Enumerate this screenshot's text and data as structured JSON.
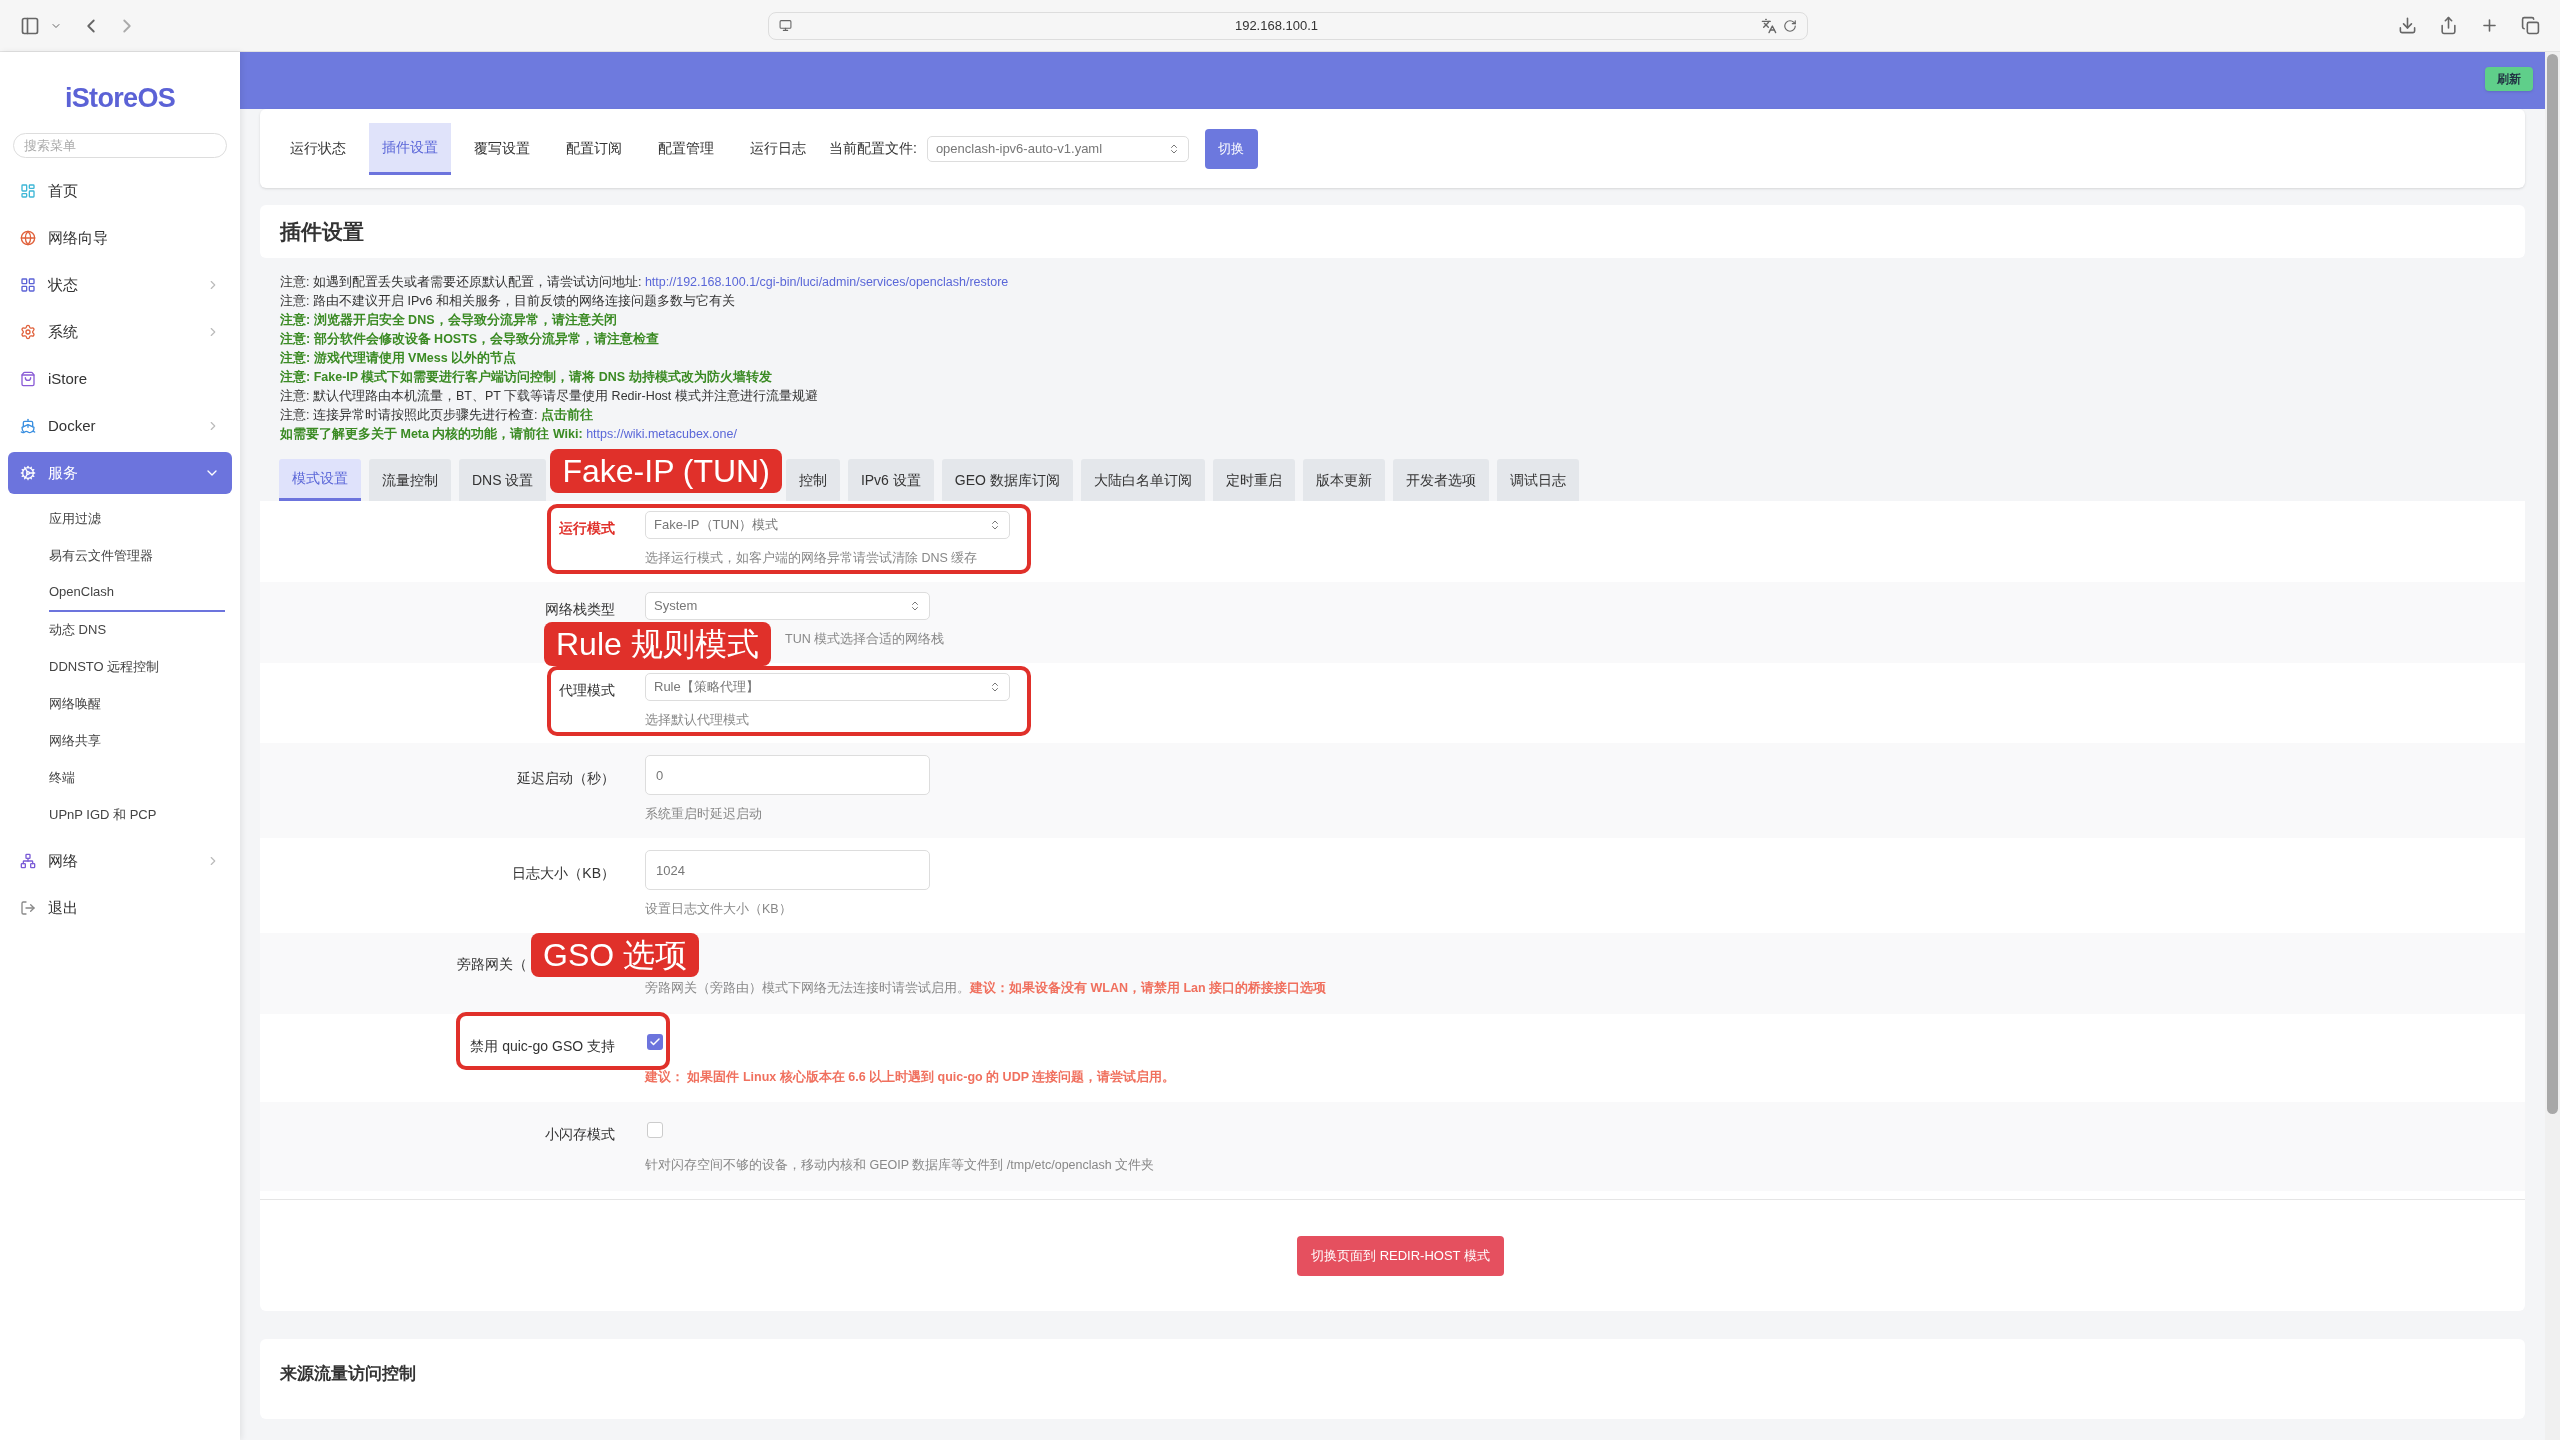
{
  "browser": {
    "url": "192.168.100.1"
  },
  "sidebar": {
    "logo": "iStoreOS",
    "search_placeholder": "搜索菜单",
    "items": [
      {
        "label": "首页",
        "selected": false
      },
      {
        "label": "网络向导",
        "selected": false
      },
      {
        "label": "状态",
        "selected": false,
        "expanded": false
      },
      {
        "label": "系统",
        "selected": false,
        "expanded": false
      },
      {
        "label": "iStore",
        "selected": false
      },
      {
        "label": "Docker",
        "selected": false,
        "expanded": false
      },
      {
        "label": "服务",
        "selected": true,
        "expanded": true,
        "children": [
          {
            "label": "应用过滤",
            "selected": false
          },
          {
            "label": "易有云文件管理器",
            "selected": false
          },
          {
            "label": "OpenClash",
            "selected": true
          },
          {
            "label": "动态 DNS",
            "selected": false
          },
          {
            "label": "DDNSTO 远程控制",
            "selected": false
          },
          {
            "label": "网络唤醒",
            "selected": false
          },
          {
            "label": "网络共享",
            "selected": false
          },
          {
            "label": "终端",
            "selected": false
          },
          {
            "label": "UPnP IGD 和 PCP",
            "selected": false
          }
        ]
      },
      {
        "label": "网络",
        "selected": false,
        "expanded": false
      },
      {
        "label": "退出",
        "selected": false
      }
    ]
  },
  "header": {
    "refresh_button": "刷新"
  },
  "top_tabs": [
    {
      "label": "运行状态",
      "selected": false
    },
    {
      "label": "插件设置",
      "selected": true
    },
    {
      "label": "覆写设置",
      "selected": false
    },
    {
      "label": "配置订阅",
      "selected": false
    },
    {
      "label": "配置管理",
      "selected": false
    },
    {
      "label": "运行日志",
      "selected": false
    }
  ],
  "config_file": {
    "label": "当前配置文件:",
    "value": "openclash-ipv6-auto-v1.yaml",
    "button": "切换"
  },
  "section_title": "插件设置",
  "notes": [
    {
      "kind": "plain",
      "text": "注意: 如遇到配置丢失或者需要还原默认配置，请尝试访问地址: ",
      "link": "http://192.168.100.1/cgi-bin/luci/admin/services/openclash/restore"
    },
    {
      "kind": "plain",
      "text": "注意: 路由不建议开启 IPv6 和相关服务，目前反馈的网络连接问题多数与它有关"
    },
    {
      "kind": "highlight",
      "text": "注意: 浏览器开启安全 DNS，会导致分流异常，请注意关闭"
    },
    {
      "kind": "highlight",
      "text": "注意: 部分软件会修改设备 HOSTS，会导致分流异常，请注意检查"
    },
    {
      "kind": "highlight",
      "text": "注意: 游戏代理请使用 VMess 以外的节点"
    },
    {
      "kind": "highlight",
      "text": "注意: Fake-IP 模式下如需要进行客户端访问控制，请将 DNS 劫持模式改为防火墙转发"
    },
    {
      "kind": "plain",
      "text": "注意: 默认代理路由本机流量，BT、PT 下载等请尽量使用 Redir-Host 模式并注意进行流量规避"
    },
    {
      "kind": "plain",
      "text": "注意: 连接异常时请按照此页步骤先进行检查: **点击前往**"
    },
    {
      "kind": "highlight",
      "text": "如需要了解更多关于 Meta 内核的功能，请前往 Wiki: ",
      "link": "https://wiki.metacubex.one/"
    }
  ],
  "settings_tabs": {
    "items": [
      {
        "kind": "tab",
        "label": "模式设置",
        "selected": true
      },
      {
        "kind": "tab",
        "label": "流量控制",
        "selected": false
      },
      {
        "kind": "tab",
        "label": "DNS 设置",
        "selected": false
      },
      {
        "kind": "annotation",
        "label": "Fake-IP (TUN)"
      },
      {
        "kind": "tab",
        "label": "控制",
        "selected": false
      },
      {
        "kind": "tab",
        "label": "IPv6 设置",
        "selected": false
      },
      {
        "kind": "tab",
        "label": "GEO 数据库订阅",
        "selected": false
      },
      {
        "kind": "tab",
        "label": "大陆白名单订阅",
        "selected": false
      },
      {
        "kind": "tab",
        "label": "定时重启",
        "selected": false
      },
      {
        "kind": "tab",
        "label": "版本更新",
        "selected": false
      },
      {
        "kind": "tab",
        "label": "开发者选项",
        "selected": false
      },
      {
        "kind": "tab",
        "label": "调试日志",
        "selected": false
      }
    ]
  },
  "rows": [
    {
      "kind": "select",
      "label": "运行模式",
      "value": "Fake-IP（TUN）模式",
      "help": "选择运行模式，如客户端的网络异常请尝试清除 DNS 缓存",
      "invalid": true,
      "boxed": true,
      "warning": false
    },
    {
      "kind": "select",
      "label": "网络栈类型",
      "value": "System",
      "help": "TUN 模式选择合适的网络栈",
      "callout": "Rule 规则模式",
      "invalid": false,
      "boxed": false,
      "warning": false
    },
    {
      "kind": "select",
      "label": "代理模式",
      "value": "Rule【策略代理】",
      "help": "选择默认代理模式",
      "invalid": false,
      "boxed": true,
      "warning": false
    },
    {
      "kind": "input",
      "label": "延迟启动（秒）",
      "value": "0",
      "help": "系统重启时延迟启动",
      "invalid": false,
      "boxed": false,
      "warning": false
    },
    {
      "kind": "input",
      "label": "日志大小（KB）",
      "value": "1024",
      "help": "设置日志文件大小（KB）",
      "invalid": false,
      "boxed": false,
      "warning": false
    },
    {
      "kind": "text",
      "label": "旁路网关（",
      "help": "旁路网关（旁路由）模式下网络无法连接时请尝试启用。**建议：如果设备没有 WLAN，请禁用 Lan 接口的桥接接口选项**",
      "callout": "GSO 选项",
      "invalid": false,
      "boxed": false,
      "warning": false
    },
    {
      "kind": "checkbox",
      "label": "禁用 quic-go GSO 支持",
      "checked": true,
      "help": "建议： 如果固件 Linux 核心版本在 6.6 以上时遇到 quic-go 的 UDP 连接问题，请尝试启用。",
      "invalid": false,
      "boxed": true,
      "warning": true
    },
    {
      "kind": "checkbox",
      "label": "小闪存模式",
      "checked": false,
      "help": "针对闪存空间不够的设备，移动内核和 GEOIP 数据库等文件到 /tmp/etc/openclash 文件夹",
      "invalid": false,
      "boxed": false,
      "warning": false
    }
  ],
  "switch_button": "切换页面到 REDIR-HOST 模式",
  "next_section_title": "来源流量访问控制"
}
